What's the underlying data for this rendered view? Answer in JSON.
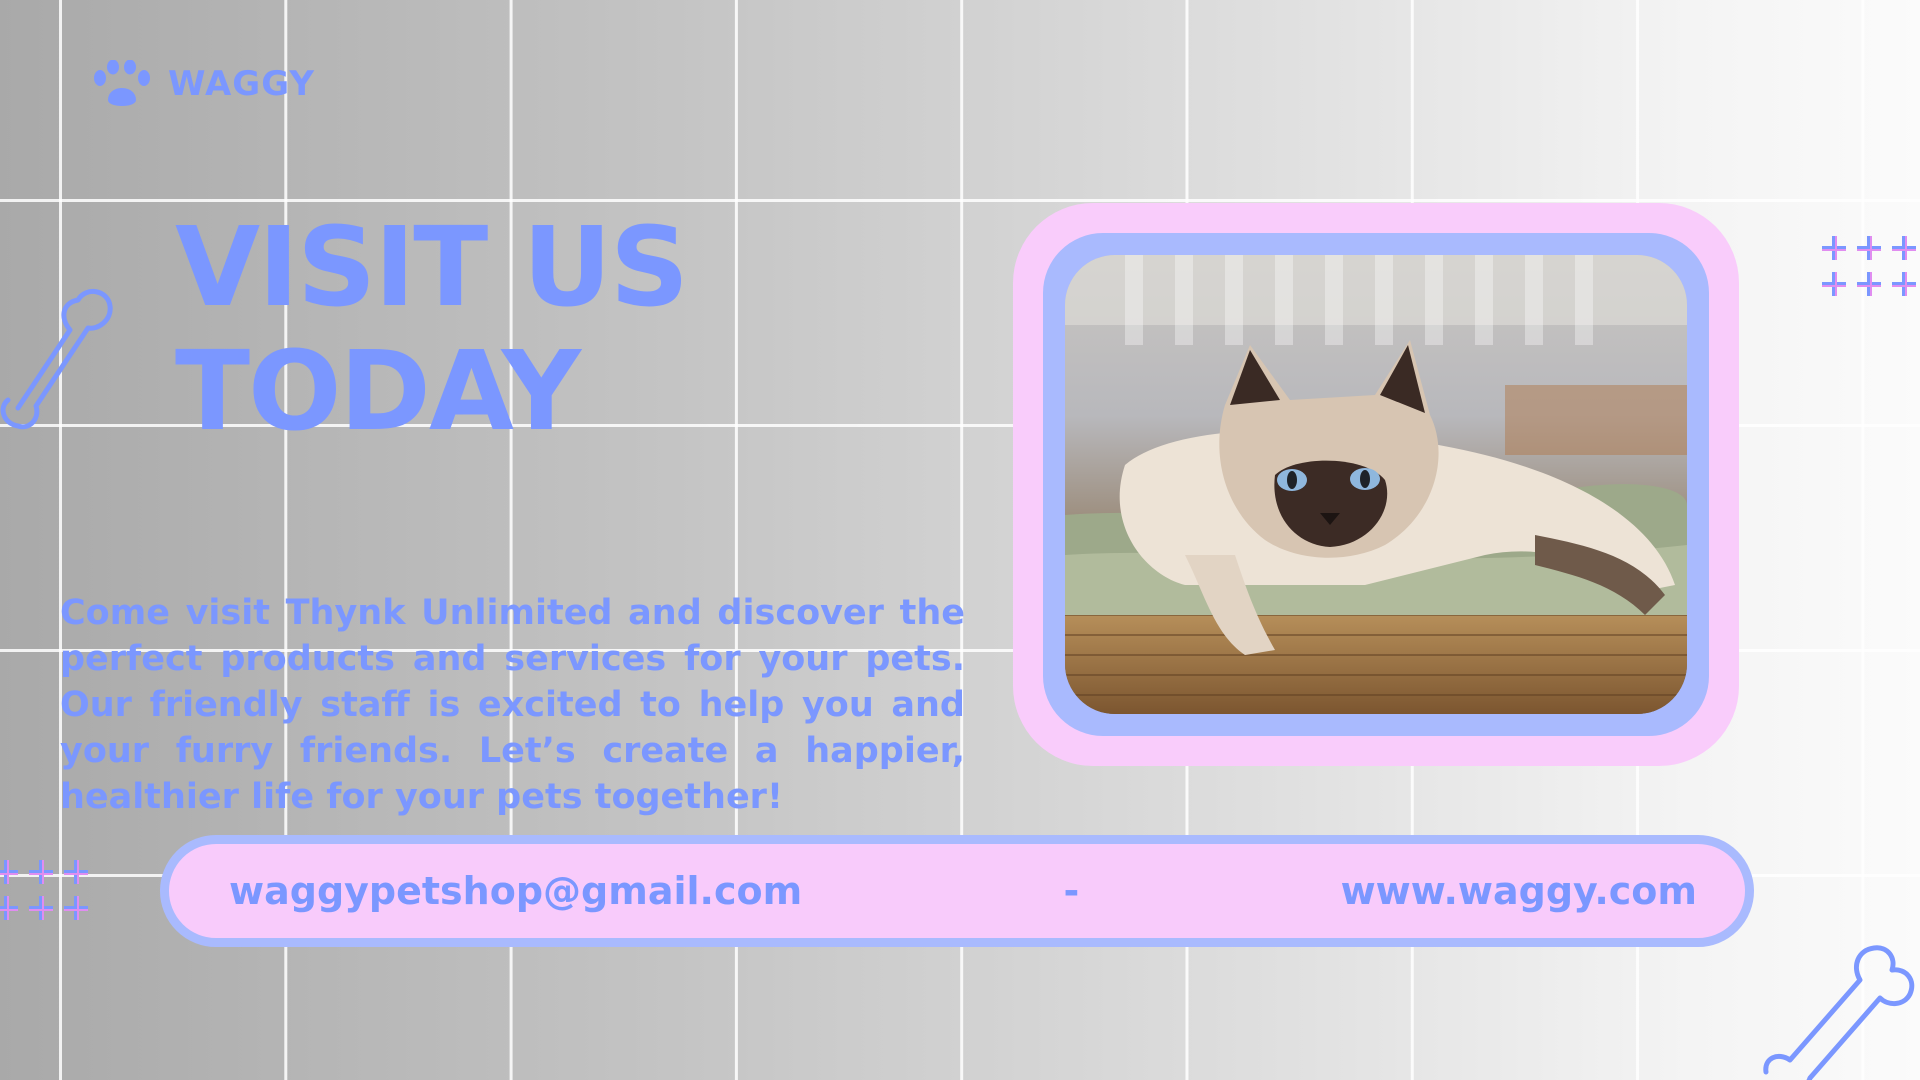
{
  "brand": {
    "name": "WAGGY",
    "icon": "paw-icon"
  },
  "headline": {
    "line1": "VISIT US",
    "line2": "TODAY"
  },
  "description": "Come visit Thynk Unlimited and discover the perfect products and services for your pets. Our friendly staff is excited to help you and your furry friends. Let’s create a happier, healthier life for your pets together!",
  "contact": {
    "email": "waggypetshop@gmail.com",
    "separator": "-",
    "website": "www.waggy.com"
  },
  "photo": {
    "subject": "siamese-cat-photo"
  },
  "colors": {
    "accent_blue": "#7b97ff",
    "frame_pink": "#f9ccfb",
    "frame_blue": "#a9bafe",
    "plus_magenta": "#d56ae6"
  },
  "decorations": [
    "bone-icon",
    "bone-icon",
    "plus-cluster-icon",
    "plus-cluster-icon"
  ]
}
